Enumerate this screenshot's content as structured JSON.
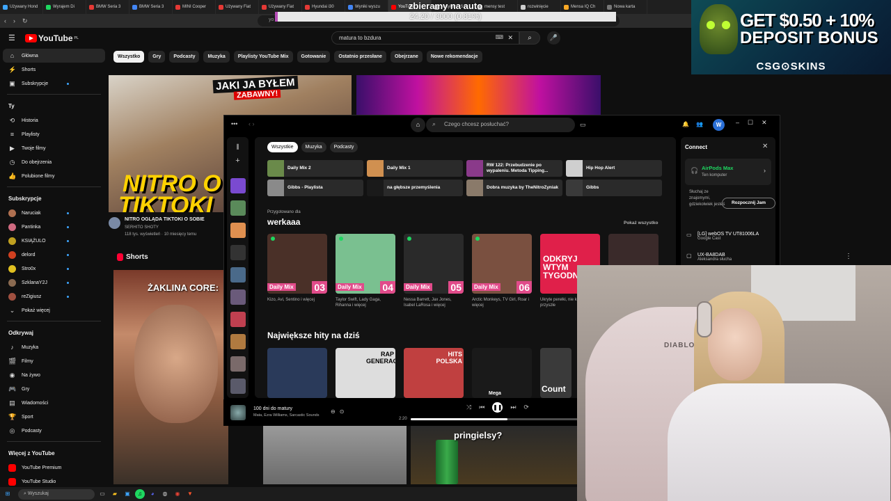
{
  "browser": {
    "tabs": [
      {
        "label": "Używany Hond",
        "color": "#3ea6ff"
      },
      {
        "label": "Wyrajem Di",
        "color": "#1ed760"
      },
      {
        "label": "BMW Seria 3",
        "color": "#e53935"
      },
      {
        "label": "BMW Seria 3",
        "color": "#4285f4"
      },
      {
        "label": "MINI Cooper",
        "color": "#e53935"
      },
      {
        "label": "Używany Fiat",
        "color": "#e53935"
      },
      {
        "label": "Używany Fiat",
        "color": "#e53935"
      },
      {
        "label": "Hyundai i30",
        "color": "#e53935"
      },
      {
        "label": "Wyniki wyszu",
        "color": "#4285f4"
      },
      {
        "label": "YouTube",
        "color": "#ff0000",
        "active": true
      },
      {
        "label": "watykan - Szu",
        "color": "#cccccc"
      },
      {
        "label": "mensy test",
        "color": "#cccccc"
      },
      {
        "label": "rozwinięcie",
        "color": "#cccccc"
      },
      {
        "label": "Mensa IQ Ch",
        "color": "#f9a825"
      },
      {
        "label": "Nowa karta",
        "color": "#777777"
      }
    ],
    "url_text": "yo",
    "overlay_title": "zbieramy na auto",
    "overlay_progress_text": "24.20 / 3000 (0.81%)",
    "overlay_progress_fraction": 0.0081
  },
  "ad": {
    "line1": "GET $0.50 + 10%",
    "line2": "DEPOSIT BONUS",
    "brand": "CSG⊙SKINS"
  },
  "youtube": {
    "logo": "YouTube",
    "logo_region": "PL",
    "search_value": "matura to bzdura",
    "chips": [
      "Wszystko",
      "Gry",
      "Podcasty",
      "Muzyka",
      "Playlisty YouTube Mix",
      "Gotowanie",
      "Ostatnio przesłane",
      "Obejrzane",
      "Nowe rekomendacje"
    ],
    "sidebar": {
      "main": [
        {
          "label": "Główna",
          "icon": "⌂"
        },
        {
          "label": "Shorts",
          "icon": "⚡"
        },
        {
          "label": "Subskrypcje",
          "icon": "▣"
        }
      ],
      "you_header": "Ty",
      "you": [
        {
          "label": "Historia",
          "icon": "⟲"
        },
        {
          "label": "Playlisty",
          "icon": "≡"
        },
        {
          "label": "Twoje filmy",
          "icon": "▶"
        },
        {
          "label": "Do obejrzenia",
          "icon": "◷"
        },
        {
          "label": "Polubione filmy",
          "icon": "👍"
        }
      ],
      "subs_header": "Subskrypcje",
      "subs": [
        {
          "label": "Naruciak",
          "color": "#b07050"
        },
        {
          "label": "Pantinka",
          "color": "#d06a80"
        },
        {
          "label": "KSIĄŻULO",
          "color": "#c0a020"
        },
        {
          "label": "delord",
          "color": "#d04020"
        },
        {
          "label": "Stro0x",
          "color": "#e0c020"
        },
        {
          "label": "SzklanaY2J",
          "color": "#8a6a50"
        },
        {
          "label": "reZigiusz",
          "color": "#a05040"
        }
      ],
      "show_more": "Pokaż więcej",
      "explore_header": "Odkrywaj",
      "explore": [
        {
          "label": "Muzyka",
          "icon": "♪"
        },
        {
          "label": "Filmy",
          "icon": "🎬"
        },
        {
          "label": "Na żywo",
          "icon": "◉"
        },
        {
          "label": "Gry",
          "icon": "🎮"
        },
        {
          "label": "Wiadomości",
          "icon": "▤"
        },
        {
          "label": "Sport",
          "icon": "🏆"
        },
        {
          "label": "Podcasty",
          "icon": "◎"
        }
      ],
      "more_header": "Więcej z YouTube",
      "more": [
        {
          "label": "YouTube Premium",
          "color": "#ff0000"
        },
        {
          "label": "YouTube Studio",
          "color": "#ff0000"
        }
      ]
    },
    "video1": {
      "title": "NITRO OGLĄDA TIKTOKI O SOBIE",
      "channel": "SERHITO SHOTY",
      "meta": "118 tys. wyświetleń · 10 miesięcy temu",
      "thumb_top": "JAKI JA BYŁEM",
      "thumb_top2": "ZABAWNY!",
      "thumb_text1": "NITRO O",
      "thumb_text2": "TIKTOKI"
    },
    "shorts_header": "Shorts",
    "short1_caption": "ŻAKLINA CORE:",
    "short3_caption": "pringielsy?"
  },
  "spotify": {
    "search_placeholder": "Czego chcesz posłuchać?",
    "avatar_letter": "W",
    "filters": [
      "Wszystkie",
      "Muzyka",
      "Podcasty"
    ],
    "quick_picks": [
      {
        "label": "Daily Mix 2",
        "color": "#6a8a4a"
      },
      {
        "label": "Daily Mix 1",
        "color": "#d09050"
      },
      {
        "label": "RW 122: Przebudzenie po wypaleniu. Metoda Tipping...",
        "color": "#8a3a8a"
      },
      {
        "label": "Hip Hop Alert",
        "color": "#cfcfcf"
      },
      {
        "label": "Gibbs - Playlista",
        "color": "#8a8a8a"
      },
      {
        "label": "na głębsze przemyślenia",
        "color": "#1a1a1a"
      },
      {
        "label": "Dobra muzyka by TheNitroZyniak",
        "color": "#8a7a6a"
      },
      {
        "label": "Gibbs",
        "color": "#3a3a3a"
      }
    ],
    "made_for": "Przygotowano dla",
    "made_for_name": "werkaaa",
    "show_all": "Pokaż wszystko",
    "mixes": [
      {
        "label": "Daily Mix",
        "num": "03",
        "artists": "Kizo, Avi, Sentino i więcej",
        "color": "#4a3028"
      },
      {
        "label": "Daily Mix",
        "num": "04",
        "artists": "Taylor Swift, Lady Gaga, Rihanna i więcej",
        "color": "#7ac090"
      },
      {
        "label": "Daily Mix",
        "num": "05",
        "artists": "Nessa Barrett, Jax Jones, Isabel LaRosa i więcej",
        "color": "#2a2a2a"
      },
      {
        "label": "Daily Mix",
        "num": "06",
        "artists": "Arctic Monkeys, TV Girl, Roar i więcej",
        "color": "#7a5040"
      },
      {
        "label": "ODKRYJ WTYM TYGODNIU",
        "num": "",
        "artists": "Ukryte perełki, nie kawałki i przyszłe",
        "color": "#e0204a"
      },
      {
        "label": "",
        "num": "",
        "artists": "",
        "color": "#3a2a2a"
      }
    ],
    "hits_title": "Największe hity na dziś",
    "hits": [
      {
        "color": "#2a3a5a",
        "text": ""
      },
      {
        "color": "#dddddd",
        "text": "RAP GENERACJA"
      },
      {
        "color": "#c04040",
        "text": "HITS POLSKA"
      },
      {
        "color": "#1a1a1a",
        "text": "Mega"
      },
      {
        "color": "#3a3a3a",
        "text": "Count"
      }
    ],
    "connect_title": "Connect",
    "airpods_name": "AirPods Max",
    "airpods_sub": "Ten komputer",
    "jam_text": "Słuchaj ze znajomymi, gdziekolwiek jesteś",
    "jam_button": "Rozpocznij Jam",
    "devices": [
      {
        "name": "[LG] webOS TV UT81006LA",
        "sub": "Google Cast"
      },
      {
        "name": "UX-BA8DAB",
        "sub": "Aleksandra słucha"
      }
    ],
    "now_playing_title": "100 dni do matury",
    "now_playing_artist": "Mata, Ezra Williams, Sarcastic Sounds",
    "elapsed": "2:20",
    "progress_fraction": 0.58
  },
  "webcam": {
    "chair_logo": "DIABLO"
  },
  "taskbar": {
    "search_placeholder": "Wyszukaj"
  }
}
